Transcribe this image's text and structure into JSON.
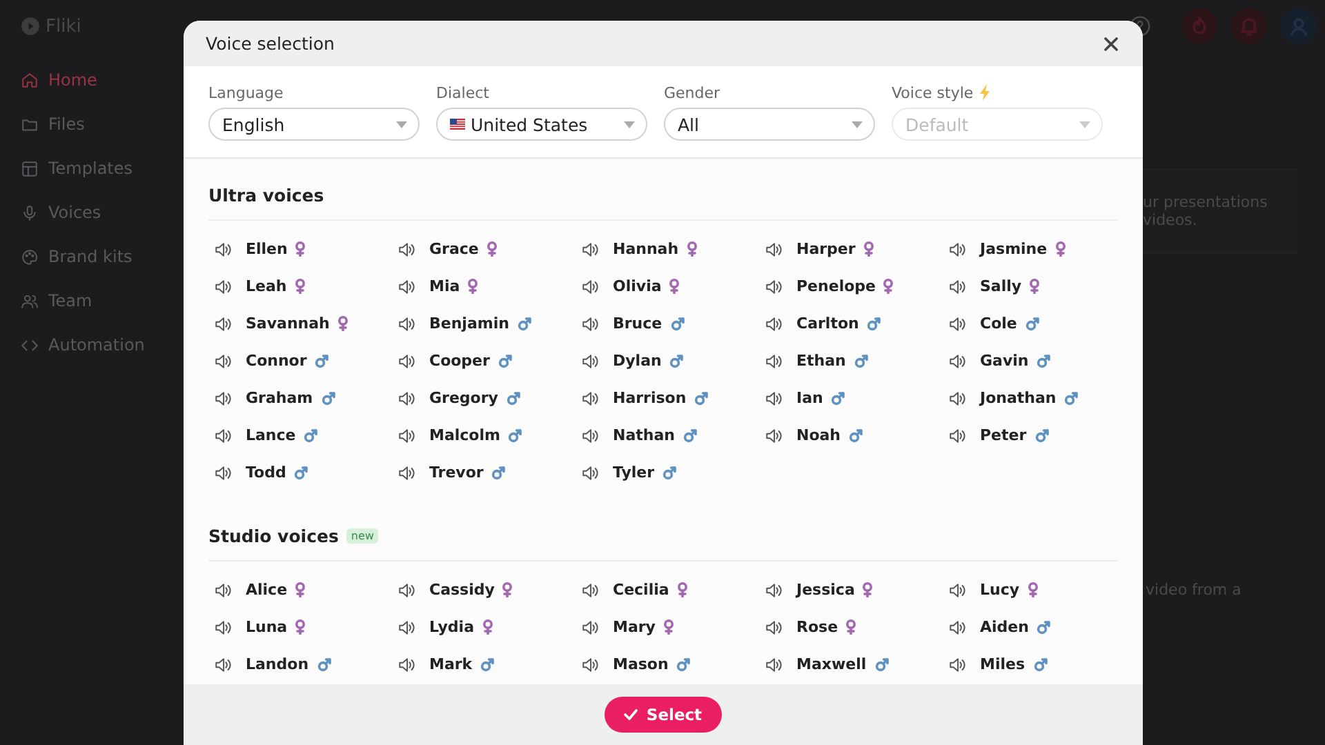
{
  "app": {
    "logo": "Fliki"
  },
  "sidebar": {
    "items": [
      {
        "label": "Home",
        "selected": true
      },
      {
        "label": "Files",
        "selected": false
      },
      {
        "label": "Templates",
        "selected": false
      },
      {
        "label": "Voices",
        "selected": false
      },
      {
        "label": "Brand kits",
        "selected": false
      },
      {
        "label": "Team",
        "selected": false
      },
      {
        "label": "Automation",
        "selected": false
      }
    ]
  },
  "background_text": [
    {
      "text": "ur presentations"
    },
    {
      "text": "videos."
    },
    {
      "text": "video from a"
    }
  ],
  "dialog": {
    "title": "Voice selection",
    "filters": [
      {
        "label": "Language",
        "value": "English",
        "flag": false,
        "disabled": false,
        "bolt": false
      },
      {
        "label": "Dialect",
        "value": "United States",
        "flag": true,
        "disabled": false,
        "bolt": false
      },
      {
        "label": "Gender",
        "value": "All",
        "flag": false,
        "disabled": false,
        "bolt": false
      },
      {
        "label": "Voice style",
        "value": "Default",
        "flag": false,
        "disabled": true,
        "bolt": true
      }
    ],
    "sections": [
      {
        "title": "Ultra voices",
        "voices": [
          {
            "name": "Ellen",
            "kind": "female"
          },
          {
            "name": "Grace",
            "kind": "female"
          },
          {
            "name": "Hannah",
            "kind": "female"
          },
          {
            "name": "Harper",
            "kind": "female"
          },
          {
            "name": "Jasmine",
            "kind": "female"
          },
          {
            "name": "Leah",
            "kind": "female"
          },
          {
            "name": "Mia",
            "kind": "female"
          },
          {
            "name": "Olivia",
            "kind": "female"
          },
          {
            "name": "Penelope",
            "kind": "female"
          },
          {
            "name": "Sally",
            "kind": "female"
          },
          {
            "name": "Savannah",
            "kind": "female"
          },
          {
            "name": "Benjamin",
            "kind": "male"
          },
          {
            "name": "Bruce",
            "kind": "male"
          },
          {
            "name": "Carlton",
            "kind": "male"
          },
          {
            "name": "Cole",
            "kind": "male"
          },
          {
            "name": "Connor",
            "kind": "male"
          },
          {
            "name": "Cooper",
            "kind": "male"
          },
          {
            "name": "Dylan",
            "kind": "male"
          },
          {
            "name": "Ethan",
            "kind": "male"
          },
          {
            "name": "Gavin",
            "kind": "male"
          },
          {
            "name": "Graham",
            "kind": "male"
          },
          {
            "name": "Gregory",
            "kind": "male"
          },
          {
            "name": "Harrison",
            "kind": "male"
          },
          {
            "name": "Ian",
            "kind": "male"
          },
          {
            "name": "Jonathan",
            "kind": "male"
          },
          {
            "name": "Lance",
            "kind": "male"
          },
          {
            "name": "Malcolm",
            "kind": "male"
          },
          {
            "name": "Nathan",
            "kind": "male"
          },
          {
            "name": "Noah",
            "kind": "male"
          },
          {
            "name": "Peter",
            "kind": "male"
          },
          {
            "name": "Todd",
            "kind": "male"
          },
          {
            "name": "Trevor",
            "kind": "male"
          },
          {
            "name": "Tyler",
            "kind": "male"
          }
        ]
      },
      {
        "title": "Studio voices",
        "badge": "new",
        "voices": [
          {
            "name": "Alice",
            "kind": "female"
          },
          {
            "name": "Cassidy",
            "kind": "female"
          },
          {
            "name": "Cecilia",
            "kind": "female"
          },
          {
            "name": "Jessica",
            "kind": "female"
          },
          {
            "name": "Lucy",
            "kind": "female"
          },
          {
            "name": "Luna",
            "kind": "female"
          },
          {
            "name": "Lydia",
            "kind": "female"
          },
          {
            "name": "Mary",
            "kind": "female"
          },
          {
            "name": "Rose",
            "kind": "female"
          },
          {
            "name": "Aiden",
            "kind": "male"
          },
          {
            "name": "Landon",
            "kind": "male"
          },
          {
            "name": "Mark",
            "kind": "male"
          },
          {
            "name": "Mason",
            "kind": "male"
          },
          {
            "name": "Maxwell",
            "kind": "male"
          },
          {
            "name": "Miles",
            "kind": "male"
          }
        ]
      }
    ],
    "action": "Select"
  }
}
